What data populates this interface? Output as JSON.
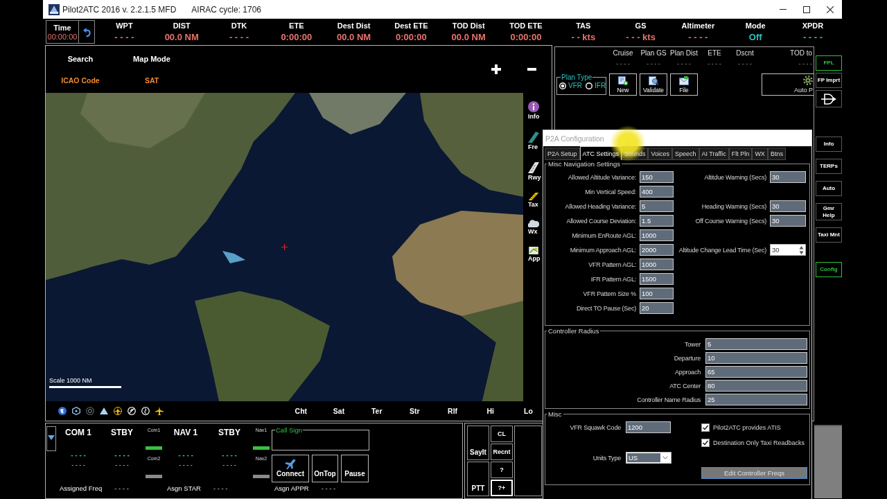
{
  "window": {
    "title": "Pilot2ATC 2016 v. 2.2.1.5 MFD",
    "airac": "AIRAC cycle: 1706"
  },
  "header": {
    "time": {
      "label": "Time",
      "value": "00:00:00"
    },
    "fields": [
      {
        "label": "WPT",
        "value": "- - - -",
        "color": "#e8736c"
      },
      {
        "label": "DIST",
        "value": "00.0 NM",
        "color": "#e8736c"
      },
      {
        "label": "DTK",
        "value": "- - - -",
        "color": "#e8736c"
      },
      {
        "label": "ETE",
        "value": "0:00:00",
        "color": "#e8736c"
      },
      {
        "label": "Dest Dist",
        "value": "00.0 NM",
        "color": "#e8736c"
      },
      {
        "label": "Dest ETE",
        "value": "0:00:00",
        "color": "#e8736c"
      },
      {
        "label": "TOD Dist",
        "value": "00.0 NM",
        "color": "#e8736c"
      },
      {
        "label": "TOD ETE",
        "value": "0:00:00",
        "color": "#e8736c"
      },
      {
        "label": "TAS",
        "value": "- - kts",
        "color": "#e8736c"
      },
      {
        "label": "GS",
        "value": "- - - kts",
        "color": "#e8736c"
      },
      {
        "label": "Altimeter",
        "value": "- - - -",
        "color": "#e8736c"
      },
      {
        "label": "Mode",
        "value": "Off",
        "color": "#2fc0c0"
      },
      {
        "label": "XPDR",
        "value": "- - - -",
        "color": "#2fc0c0"
      }
    ]
  },
  "map": {
    "search": {
      "label": "Search",
      "value": "ICAO Code"
    },
    "map_mode": {
      "label": "Map Mode",
      "value": "SAT"
    },
    "scale": "Scale 1000 NM",
    "tools": [
      {
        "kind": "info",
        "label": "Info"
      },
      {
        "kind": "freq",
        "label": "Fre"
      },
      {
        "kind": "runway",
        "label": "Rwy"
      },
      {
        "kind": "taxi",
        "label": "Tax"
      },
      {
        "kind": "weather",
        "label": "Wx"
      },
      {
        "kind": "approach",
        "label": "App"
      }
    ],
    "modes": [
      "Cht",
      "Sat",
      "Ter",
      "Str",
      "Rlf",
      "Hi",
      "Lo"
    ]
  },
  "flight_plan": {
    "columns": [
      {
        "label": "Cruise",
        "value": "- - - -"
      },
      {
        "label": "Plan GS",
        "value": "- - - -"
      },
      {
        "label": "Plan Dist",
        "value": "- - - -"
      },
      {
        "label": "ETE",
        "value": "- - - -"
      },
      {
        "label": "Dscnt",
        "value": "- - - -"
      },
      {
        "label": "TOD to",
        "value": "- - - -"
      }
    ],
    "plan_type": {
      "label": "Plan Type",
      "options": [
        {
          "label": "VFR",
          "selected": true
        },
        {
          "label": "IFR",
          "selected": false
        }
      ]
    },
    "buttons": [
      {
        "kind": "new",
        "label": "New"
      },
      {
        "kind": "validate",
        "label": "Validate"
      },
      {
        "kind": "file",
        "label": "File"
      }
    ],
    "auto": "Auto P"
  },
  "side_nav": {
    "top": [
      {
        "kind": "text",
        "label": "FPL",
        "selected": true
      },
      {
        "kind": "text",
        "label": "FP Imprt",
        "selected": false
      },
      {
        "kind": "icon",
        "selected": false
      }
    ],
    "bottom": [
      {
        "label": "Info",
        "selected": false
      },
      {
        "label": "TERPs",
        "selected": false
      },
      {
        "label": "Auto",
        "selected": false
      },
      {
        "label": "Gmr\nHelp",
        "selected": false
      },
      {
        "label": "Taxi Mnt",
        "selected": false
      },
      {
        "label": "Config",
        "selected": true
      }
    ]
  },
  "radio": {
    "groups": [
      {
        "radios": [
          {
            "label": "COM 1",
            "value": "- - - -",
            "color": "#3ccf4e",
            "sub": "- - - -"
          },
          {
            "label": "STBY",
            "value": "- - - -",
            "color": "#3cc8d8",
            "sub": "- - - -"
          }
        ],
        "select": [
          {
            "label": "Com1",
            "on": true
          },
          {
            "label": "Com2",
            "on": false
          }
        ]
      },
      {
        "radios": [
          {
            "label": "NAV 1",
            "value": "- - - -",
            "color": "#3ccf4e",
            "sub": "- - - -"
          },
          {
            "label": "STBY",
            "value": "- - - -",
            "color": "#3ccf4e",
            "sub": "- - - -"
          }
        ],
        "select": [
          {
            "label": "Nav1",
            "on": true
          },
          {
            "label": "Nav2",
            "on": false
          }
        ]
      }
    ],
    "call_sign": "Call Sign",
    "buttons": [
      {
        "kind": "connect",
        "label": "Connect"
      },
      {
        "kind": "ontop",
        "label": "OnTop"
      },
      {
        "kind": "pause",
        "label": "Pause"
      }
    ],
    "assigned": [
      {
        "label": "Assigned Freq",
        "value": "- - - -"
      },
      {
        "label": "Asgn STAR",
        "value": "- - - -"
      },
      {
        "label": "Asgn APPR",
        "value": "- - - -"
      }
    ]
  },
  "voice": {
    "buttons": [
      {
        "kind": "tall",
        "label": "SayIt",
        "focused": false
      },
      {
        "kind": "tall",
        "label": "PTT",
        "focused": false
      },
      {
        "kind": "small",
        "label": "CL",
        "focused": false
      },
      {
        "kind": "small",
        "label": "Recnt",
        "focused": false
      },
      {
        "kind": "small",
        "label": "?",
        "focused": false
      },
      {
        "kind": "small",
        "label": "?+",
        "focused": true
      }
    ]
  },
  "config": {
    "title": "P2A Configuration",
    "tabs": [
      {
        "label": "P2A Setup",
        "selected": false
      },
      {
        "label": "ATC Settings",
        "selected": true
      },
      {
        "label": "Sounds",
        "selected": false
      },
      {
        "label": "Voices",
        "selected": false
      },
      {
        "label": "Speech",
        "selected": false
      },
      {
        "label": "AI Traffic",
        "selected": false
      },
      {
        "label": "Flt Pln",
        "selected": false
      },
      {
        "label": "WX",
        "selected": false
      },
      {
        "label": "Btns",
        "selected": false
      }
    ],
    "nav_settings": {
      "title": "Misc Navigation Settings",
      "rows": [
        {
          "label": "Allowed Altitude Variance:",
          "value": "150",
          "side": {
            "kind": "text",
            "label": "Altitdue Warning (Secs)",
            "value": "30"
          }
        },
        {
          "label": "Min Vertical Speed:",
          "value": "400"
        },
        {
          "label": "Allowed Heading Variance:",
          "value": "5",
          "side": {
            "kind": "text",
            "label": "Heading Warning (Secs)",
            "value": "30"
          }
        },
        {
          "label": "Allowed Course Deviation:",
          "value": "1.5",
          "side": {
            "kind": "text",
            "label": "Off Course Warning (Secs)",
            "value": "30"
          }
        },
        {
          "label": "Minimum EnRoute AGL:",
          "value": "1000"
        },
        {
          "label": "Minimum Approach AGL:",
          "value": "2000",
          "side": {
            "kind": "spin",
            "label": "Altitude Change Lead Time (Sec)",
            "value": "30"
          }
        },
        {
          "label": "VFR Pattern AGL:",
          "value": "1000"
        },
        {
          "label": "IFR Pattern AGL:",
          "value": "1500"
        },
        {
          "label": "VFR Pattern Size %",
          "value": "100"
        },
        {
          "label": "Direct TO Pause (Sec)",
          "value": "20"
        }
      ]
    },
    "radius": {
      "title": "Controller Radius",
      "rows": [
        {
          "label": "Tower",
          "value": "5"
        },
        {
          "label": "Departure",
          "value": "10"
        },
        {
          "label": "Approach",
          "value": "65"
        },
        {
          "label": "ATC Center",
          "value": "80"
        },
        {
          "label": "Controller Name Radius",
          "value": "25"
        }
      ]
    },
    "misc": {
      "title": "Misc",
      "squawk": {
        "label": "VFR Squawk Code",
        "value": "1200"
      },
      "units": {
        "label": "Units Type",
        "value": "US"
      },
      "checks": [
        {
          "label": "Pilot2ATC provides ATIS",
          "checked": true
        },
        {
          "label": "Destination Only Taxi Readbacks",
          "checked": true
        }
      ],
      "button": "Edit Controller Freqs"
    }
  }
}
